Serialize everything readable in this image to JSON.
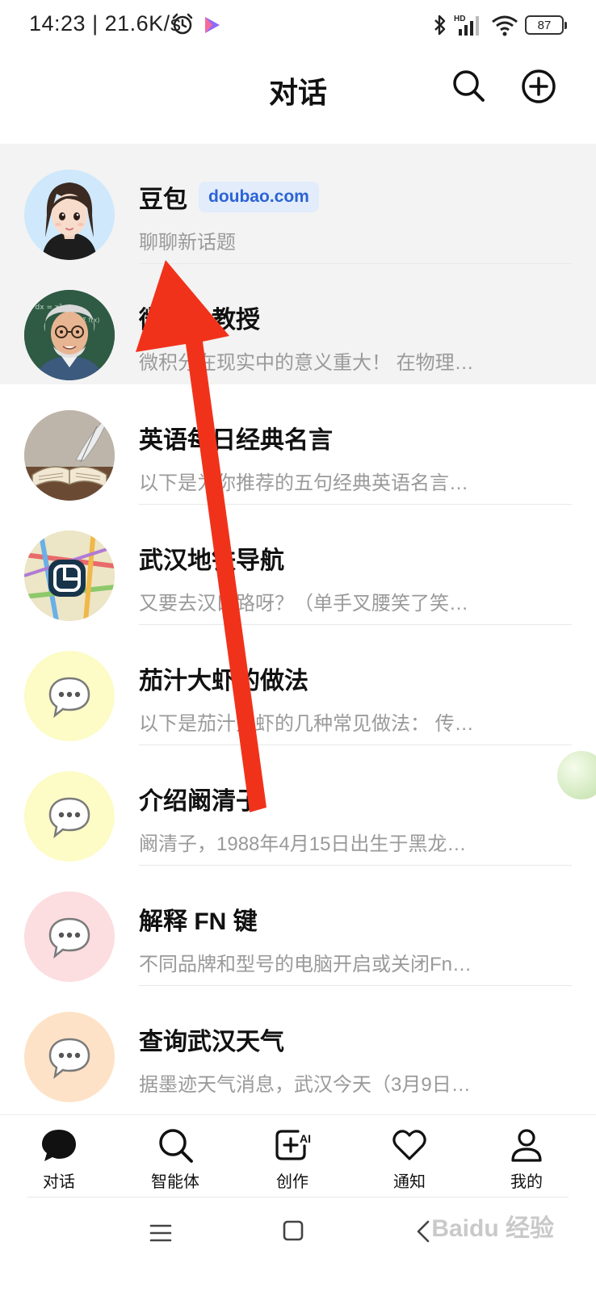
{
  "status_bar": {
    "time": "14:23 | 21.6K/s",
    "battery": "87",
    "network": "HD"
  },
  "header": {
    "title": "对话"
  },
  "conversations": [
    {
      "title": "豆包",
      "tag": "doubao.com",
      "subtitle": "聊聊新话题",
      "avatar": "girl-avatar"
    },
    {
      "title": "微积分教授",
      "subtitle": "微积分在现实中的意义重大！ 在物理…",
      "avatar": "professor-avatar"
    },
    {
      "title": "英语每日经典名言",
      "subtitle": "以下是为你推荐的五句经典英语名言…",
      "avatar": "book-avatar"
    },
    {
      "title": "武汉地铁导航",
      "subtitle": "又要去汉口路呀？（单手叉腰笑了笑…",
      "avatar": "metro-avatar"
    },
    {
      "title": "茄汁大虾的做法",
      "subtitle": "以下是茄汁大虾的几种常见做法： 传…",
      "avatar": "chat-bubble-icon",
      "color": "#fdfbc6"
    },
    {
      "title": "介绍阚清子",
      "subtitle": "阚清子，1988年4月15日出生于黑龙…",
      "avatar": "chat-bubble-icon",
      "color": "#fdfbc6"
    },
    {
      "title": "解释 FN 键",
      "subtitle": "不同品牌和型号的电脑开启或关闭Fn…",
      "avatar": "chat-bubble-icon",
      "color": "#fcdde0"
    },
    {
      "title": "查询武汉天气",
      "subtitle": "据墨迹天气消息，武汉今天（3月9日…",
      "avatar": "chat-bubble-icon",
      "color": "#fde2c7"
    }
  ],
  "tabbar": {
    "tabs": [
      {
        "label": "对话",
        "icon": "chat-icon"
      },
      {
        "label": "智能体",
        "icon": "search-icon"
      },
      {
        "label": "创作",
        "icon": "create-ai-icon"
      },
      {
        "label": "通知",
        "icon": "heart-icon"
      },
      {
        "label": "我的",
        "icon": "profile-icon"
      }
    ]
  },
  "watermark": "Baidu 经验"
}
